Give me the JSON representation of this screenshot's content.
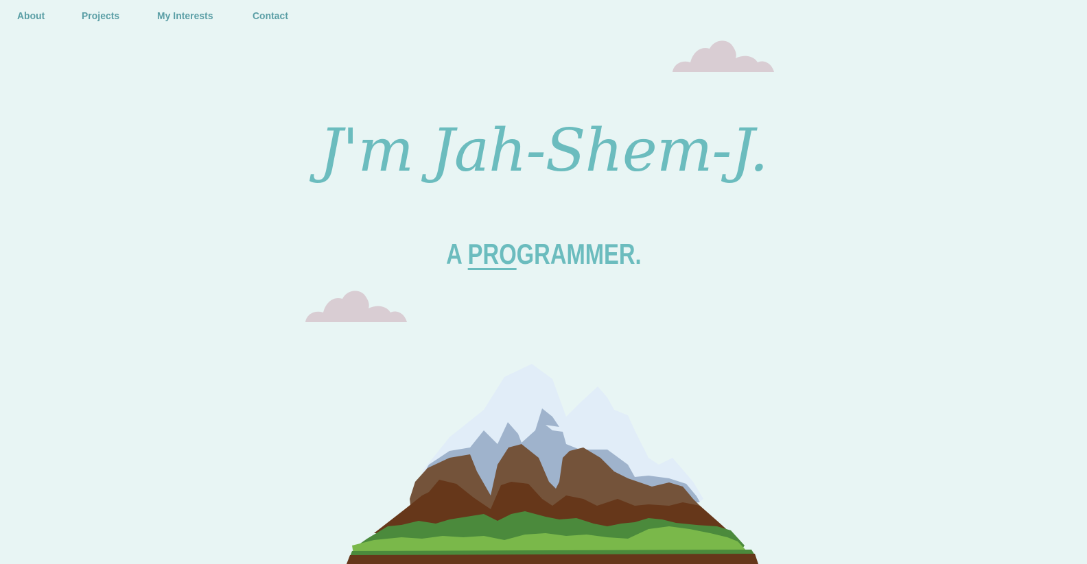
{
  "nav": {
    "items": [
      {
        "label": "About"
      },
      {
        "label": "Projects"
      },
      {
        "label": "My Interests"
      },
      {
        "label": "Contact"
      }
    ]
  },
  "hero": {
    "title": "J'm Jah-Shem-J.",
    "subtitle_prefix": "A ",
    "subtitle_typed": "PRO",
    "subtitle_rest": "GRAMMER."
  },
  "colors": {
    "background": "#e8f5f4",
    "accent": "#6bbcbe",
    "nav_text": "#5a9ea5",
    "cloud": "#d9cdd3"
  },
  "illustration": {
    "name": "mountain-illustration"
  }
}
